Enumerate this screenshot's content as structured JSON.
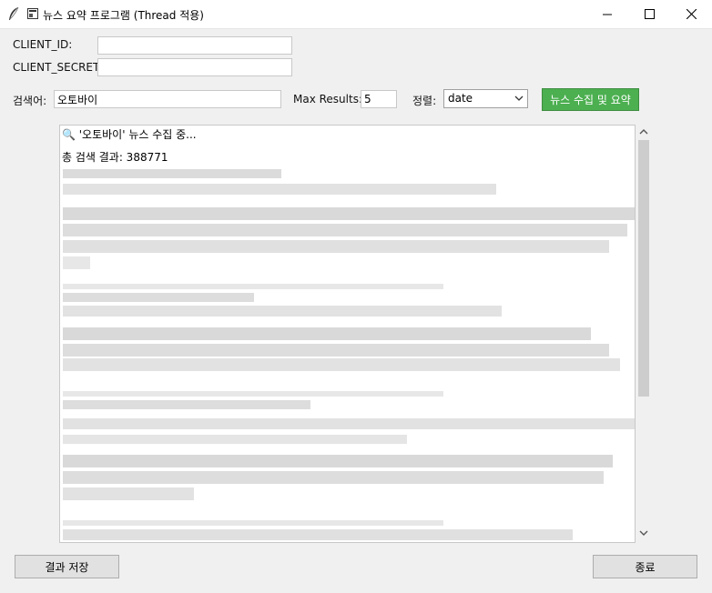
{
  "window": {
    "title": "뉴스 요약 프로그램 (Thread 적용)"
  },
  "fields": {
    "client_id": {
      "label": "CLIENT_ID:",
      "value": ""
    },
    "client_secret": {
      "label": "CLIENT_SECRET:",
      "value": ""
    },
    "search": {
      "label": "검색어:",
      "value": "오토바이"
    },
    "max_results": {
      "label": "Max Results:",
      "value": "5"
    },
    "sort": {
      "label": "정렬:",
      "value": "date"
    }
  },
  "buttons": {
    "collect": "뉴스 수집 및 요약",
    "save": "결과 저장",
    "exit": "종료"
  },
  "output": {
    "line1": "🔍 '오토바이' 뉴스 수집 중...",
    "line2": "총 검색 결과: 388771"
  },
  "colors": {
    "accent_green": "#4caf50"
  }
}
